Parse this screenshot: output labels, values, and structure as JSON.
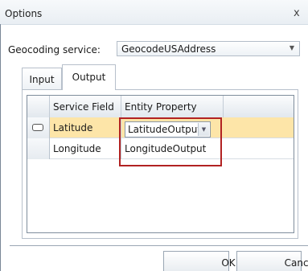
{
  "window": {
    "title": "Options",
    "close_glyph": "x"
  },
  "geocoding": {
    "label": "Geocoding service:",
    "selected": "GeocodeUSAddress",
    "dropdown_icon": "chevron-down-icon"
  },
  "tabs": [
    {
      "label": "Input",
      "active": false
    },
    {
      "label": "Output",
      "active": true
    }
  ],
  "grid": {
    "headers": [
      "Service Field",
      "Entity Property"
    ],
    "rows": [
      {
        "service_field": "Latitude",
        "entity_property": "LatitudeOutput",
        "selected": true,
        "editing": true
      },
      {
        "service_field": "Longitude",
        "entity_property": "LongitudeOutput",
        "selected": false,
        "editing": false
      }
    ]
  },
  "buttons": {
    "ok": "OK",
    "cancel": "Cancel"
  },
  "colors": {
    "selected_row": "#fde5a8",
    "highlight": "#b22222"
  }
}
